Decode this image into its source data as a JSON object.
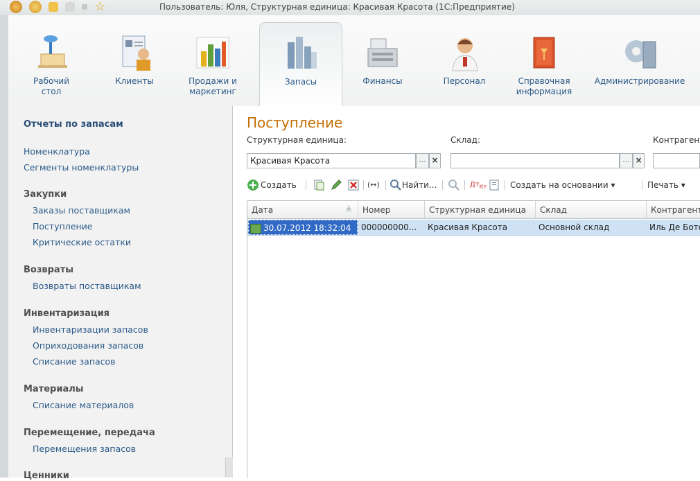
{
  "window": {
    "title": "Пользователь: Юля,  Структурная единица: Красивая Красота  (1С:Предприятие)"
  },
  "ribbon": {
    "items": [
      {
        "label": "Рабочий\nстол",
        "icon": "desk-lamp-icon"
      },
      {
        "label": "Клиенты",
        "icon": "clients-icon"
      },
      {
        "label": "Продажи и\nмаркетинг",
        "icon": "sales-chart-icon"
      },
      {
        "label": "Запасы",
        "icon": "inventory-icon"
      },
      {
        "label": "Финансы",
        "icon": "cash-register-icon"
      },
      {
        "label": "Персонал",
        "icon": "personnel-icon"
      },
      {
        "label": "Справочная\nинформация",
        "icon": "reference-book-icon"
      },
      {
        "label": "Администрирование",
        "icon": "admin-gear-icon"
      }
    ],
    "active": "Запасы"
  },
  "sidebar": {
    "heading": "Отчеты по запасам",
    "top_links": [
      "Номенклатура",
      "Сегменты номенклатуры"
    ],
    "groups": [
      {
        "title": "Закупки",
        "items": [
          "Заказы поставщикам",
          "Поступление",
          "Критические остатки"
        ]
      },
      {
        "title": "Возвраты",
        "items": [
          "Возвраты поставщикам"
        ]
      },
      {
        "title": "Инвентаризация",
        "items": [
          "Инвентаризации запасов",
          "Оприходования запасов",
          "Списание запасов"
        ]
      },
      {
        "title": "Материалы",
        "items": [
          "Списание материалов"
        ]
      },
      {
        "title": "Перемещение, передача",
        "items": [
          "Перемещения запасов"
        ]
      },
      {
        "title": "Ценники",
        "items": []
      }
    ]
  },
  "main": {
    "title": "Поступление",
    "filters": {
      "unit_label": "Структурная единица:",
      "unit_value": "Красивая Красота",
      "warehouse_label": "Склад:",
      "warehouse_value": "",
      "contractor_label": "Контрагент:",
      "contractor_value": ""
    },
    "toolbar": {
      "create": "Создать",
      "find": "Найти...",
      "create_based": "Создать на основании",
      "print": "Печать"
    },
    "table": {
      "columns": [
        "Дата",
        "Номер",
        "Структурная единица",
        "Склад",
        "Контрагент"
      ],
      "rows": [
        {
          "date": "30.07.2012 18:32:04",
          "number": "000000000...",
          "unit": "Красивая Красота",
          "warehouse": "Основной склад",
          "contractor": "Иль Де Боте"
        }
      ]
    }
  },
  "colors": {
    "accent_orange": "#c46f00",
    "link_blue": "#2a5a88",
    "selection": "#316ac5",
    "row_highlight": "#cfe2f5"
  }
}
